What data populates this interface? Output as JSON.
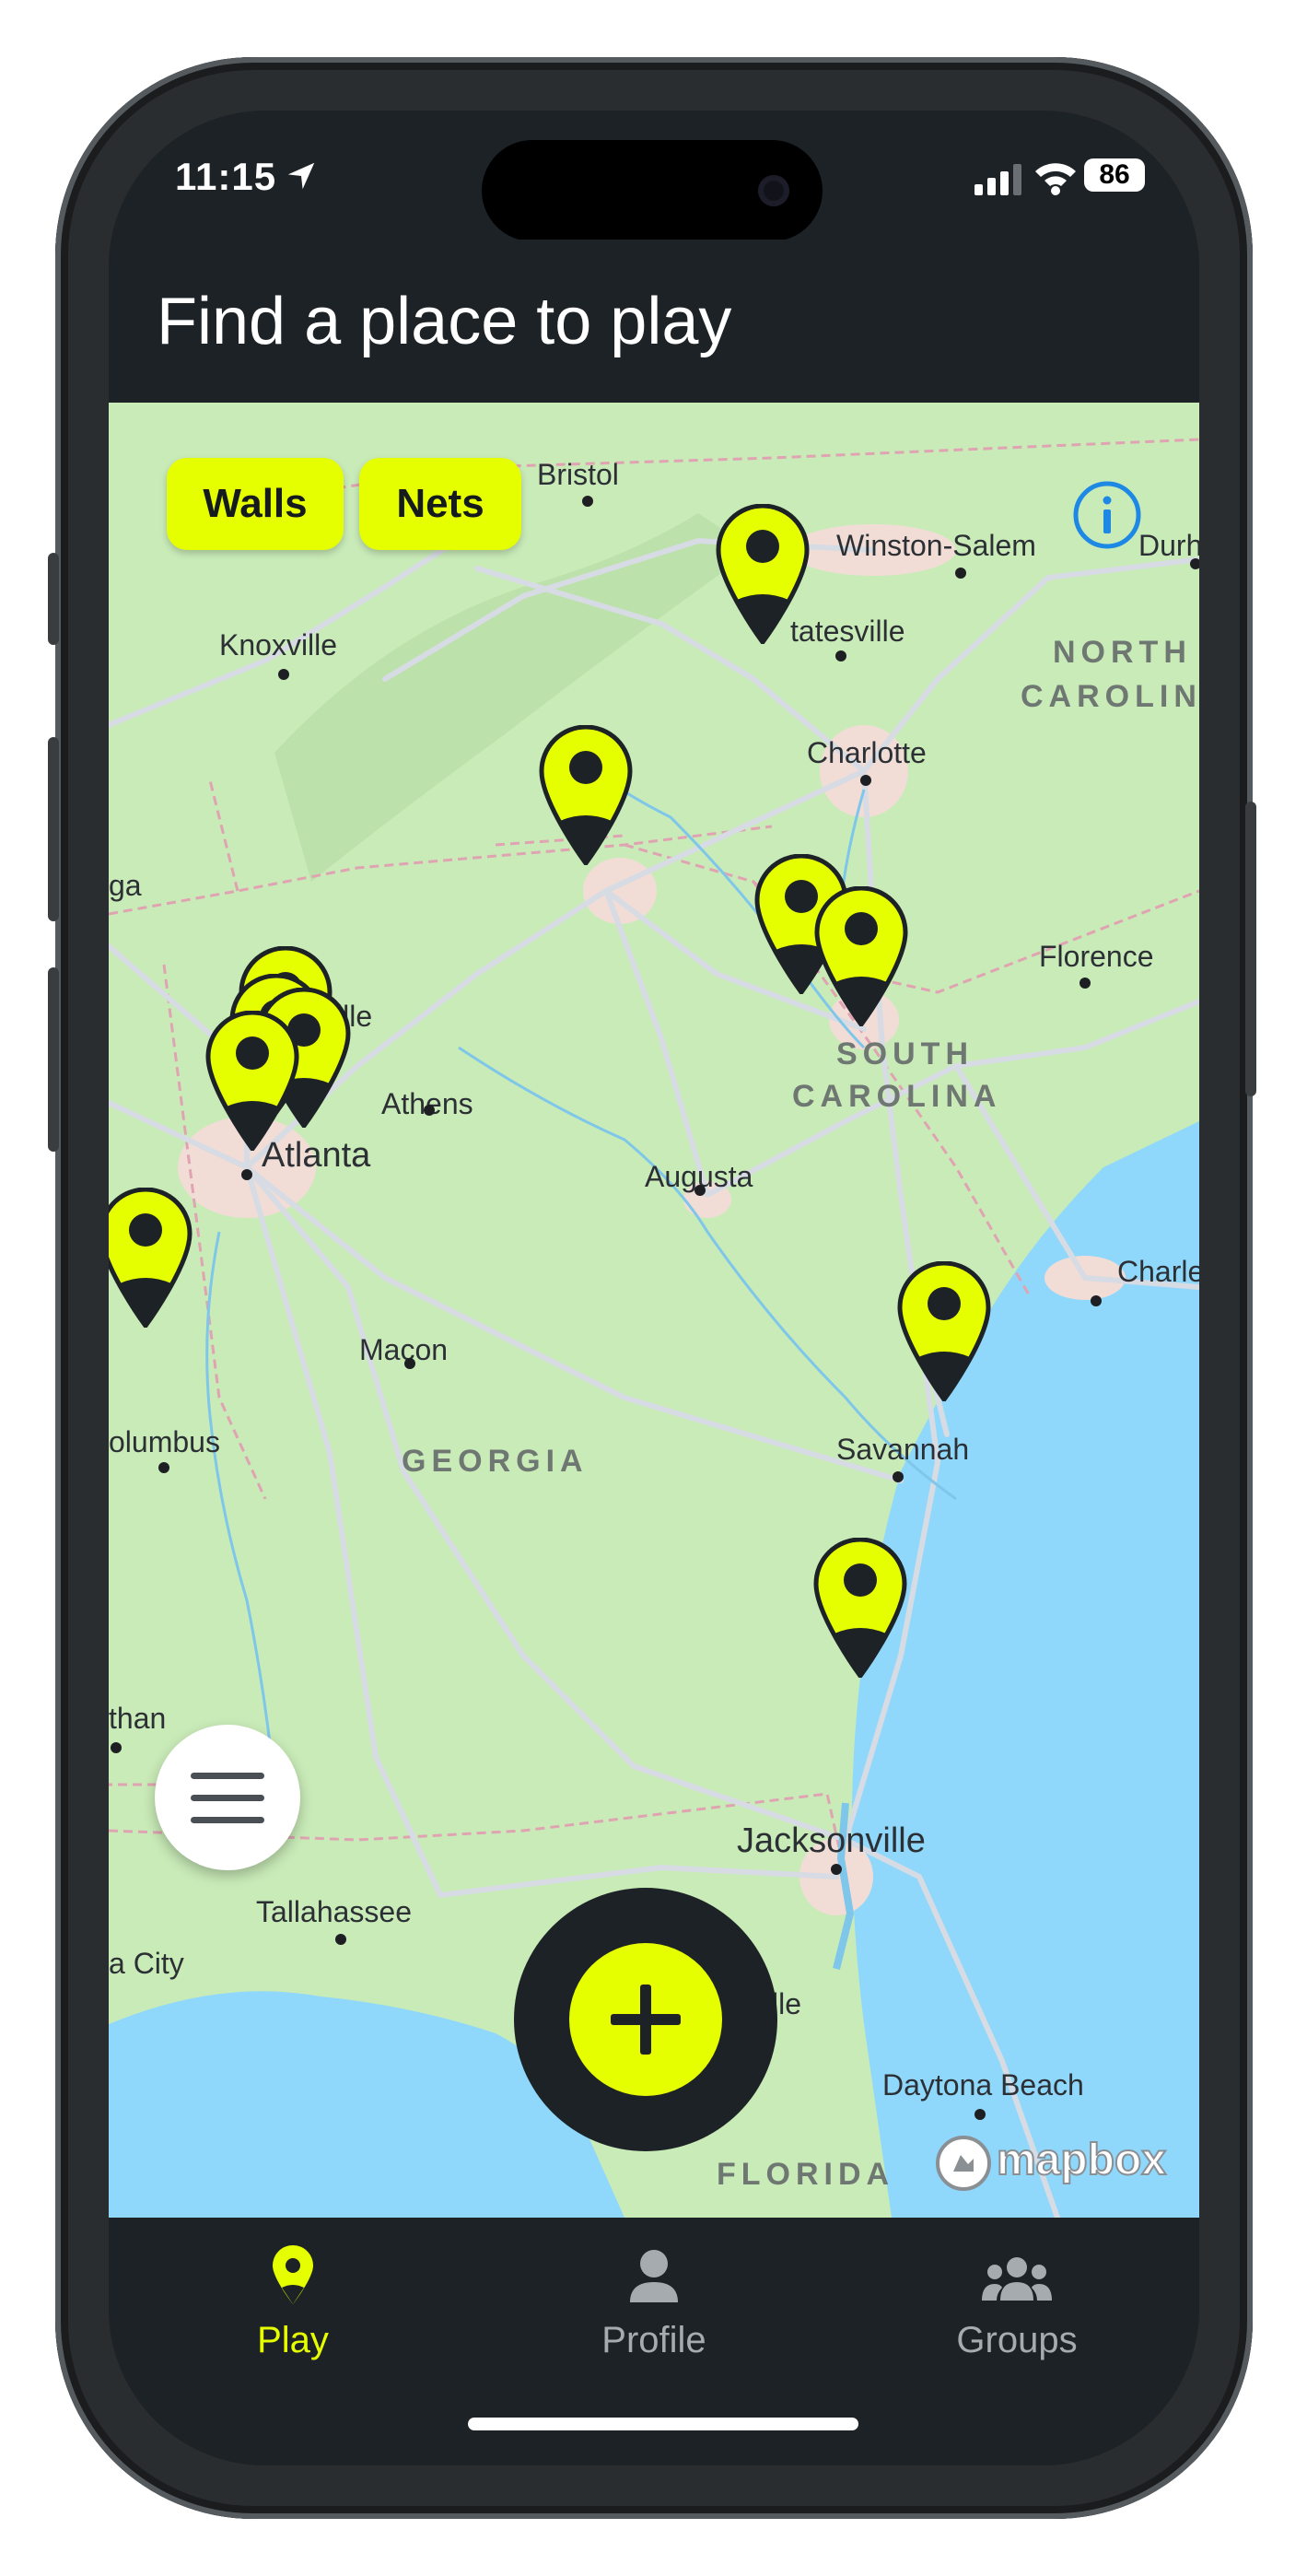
{
  "status_bar": {
    "time": "11:15",
    "battery": "86"
  },
  "header": {
    "title": "Find a place to play"
  },
  "filters": [
    {
      "label": "Walls"
    },
    {
      "label": "Nets"
    }
  ],
  "map": {
    "cities": [
      {
        "name": "Bristol"
      },
      {
        "name": "Winston-Salem"
      },
      {
        "name": "Durh"
      },
      {
        "name": "Knoxville"
      },
      {
        "name": "tatesville"
      },
      {
        "name": "Charlotte"
      },
      {
        "name": "ga"
      },
      {
        "name": "Florence"
      },
      {
        "name": "sville"
      },
      {
        "name": "Athens"
      },
      {
        "name": "Atlanta"
      },
      {
        "name": "Augusta"
      },
      {
        "name": "Charle"
      },
      {
        "name": "Macon"
      },
      {
        "name": "olumbus"
      },
      {
        "name": "Savannah"
      },
      {
        "name": "than"
      },
      {
        "name": "Jacksonville"
      },
      {
        "name": "Tallahassee"
      },
      {
        "name": "a City"
      },
      {
        "name": "lle"
      },
      {
        "name": "Daytona Beach"
      }
    ],
    "states": [
      {
        "name": "NORTH"
      },
      {
        "name": "CAROLIN"
      },
      {
        "name": "SOUTH"
      },
      {
        "name": "CAROLINA"
      },
      {
        "name": "GEORGIA"
      },
      {
        "name": "FLORIDA"
      }
    ],
    "attribution": "mapbox",
    "pin_count": 11
  },
  "tabs": [
    {
      "label": "Play",
      "icon": "map-pin-icon",
      "active": true
    },
    {
      "label": "Profile",
      "icon": "person-icon",
      "active": false
    },
    {
      "label": "Groups",
      "icon": "group-icon",
      "active": false
    }
  ],
  "colors": {
    "accent": "#e6ff00",
    "dark": "#1d2226",
    "land": "#c9ebb8",
    "water": "#8fd8fb",
    "inactive_tab": "#a6abb0"
  }
}
